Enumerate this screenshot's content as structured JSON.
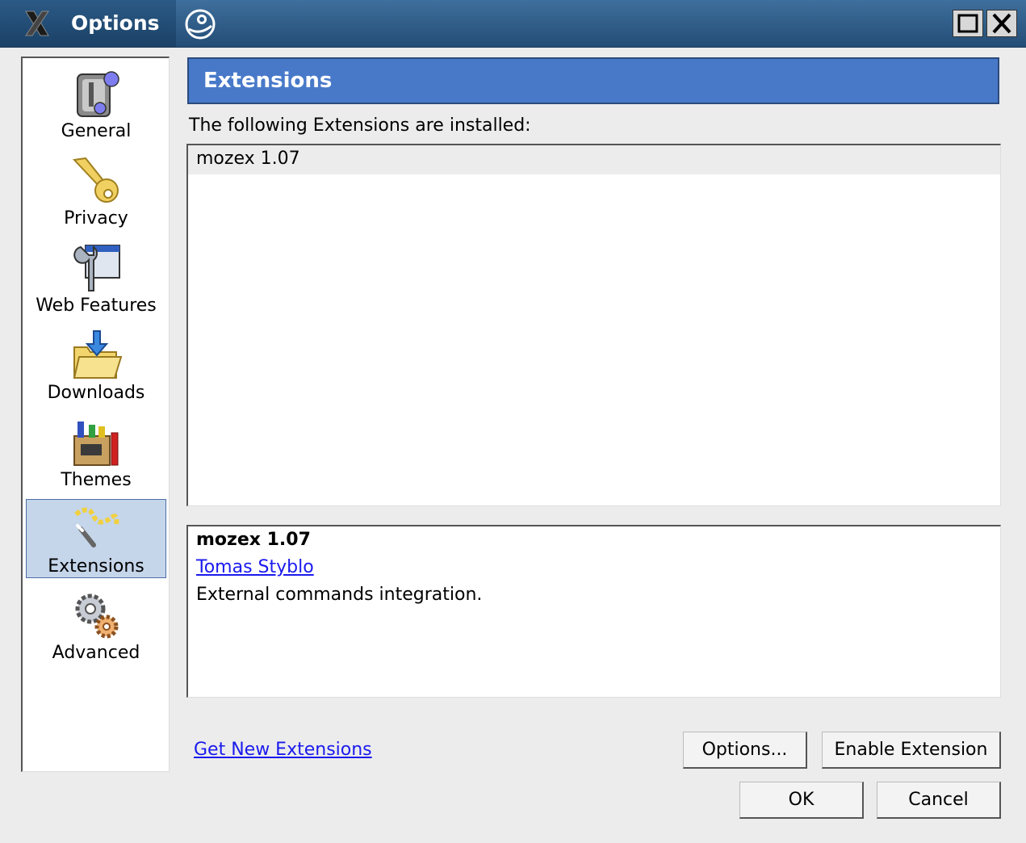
{
  "window": {
    "title": "Options"
  },
  "titlebar_icons": {
    "app": "x-logo-icon",
    "swirl": "desktop-swirl-icon",
    "maximize": "maximize-icon",
    "close": "close-icon"
  },
  "sidebar": {
    "items": [
      {
        "label": "General",
        "icon": "general-switch-icon",
        "selected": false
      },
      {
        "label": "Privacy",
        "icon": "key-icon",
        "selected": false
      },
      {
        "label": "Web Features",
        "icon": "wrench-window-icon",
        "selected": false
      },
      {
        "label": "Downloads",
        "icon": "folder-download-icon",
        "selected": false
      },
      {
        "label": "Themes",
        "icon": "paint-box-icon",
        "selected": false
      },
      {
        "label": "Extensions",
        "icon": "magic-wand-icon",
        "selected": true
      },
      {
        "label": "Advanced",
        "icon": "gears-icon",
        "selected": false
      }
    ]
  },
  "panel": {
    "header": "Extensions",
    "installed_label": "The following Extensions are installed:",
    "extensions": [
      {
        "name": "mozex 1.07"
      }
    ],
    "details": {
      "name": "mozex 1.07",
      "author": "Tomas Styblo",
      "description": "External commands integration."
    },
    "get_link": "Get New Extensions",
    "options_button": "Options...",
    "enable_button": "Enable Extension"
  },
  "dialog_buttons": {
    "ok": "OK",
    "cancel": "Cancel"
  },
  "colors": {
    "header_bg": "#4879c9",
    "selected_bg": "#c5d5ea",
    "link": "#1a1aee",
    "titlebar": "#2b5a86"
  }
}
